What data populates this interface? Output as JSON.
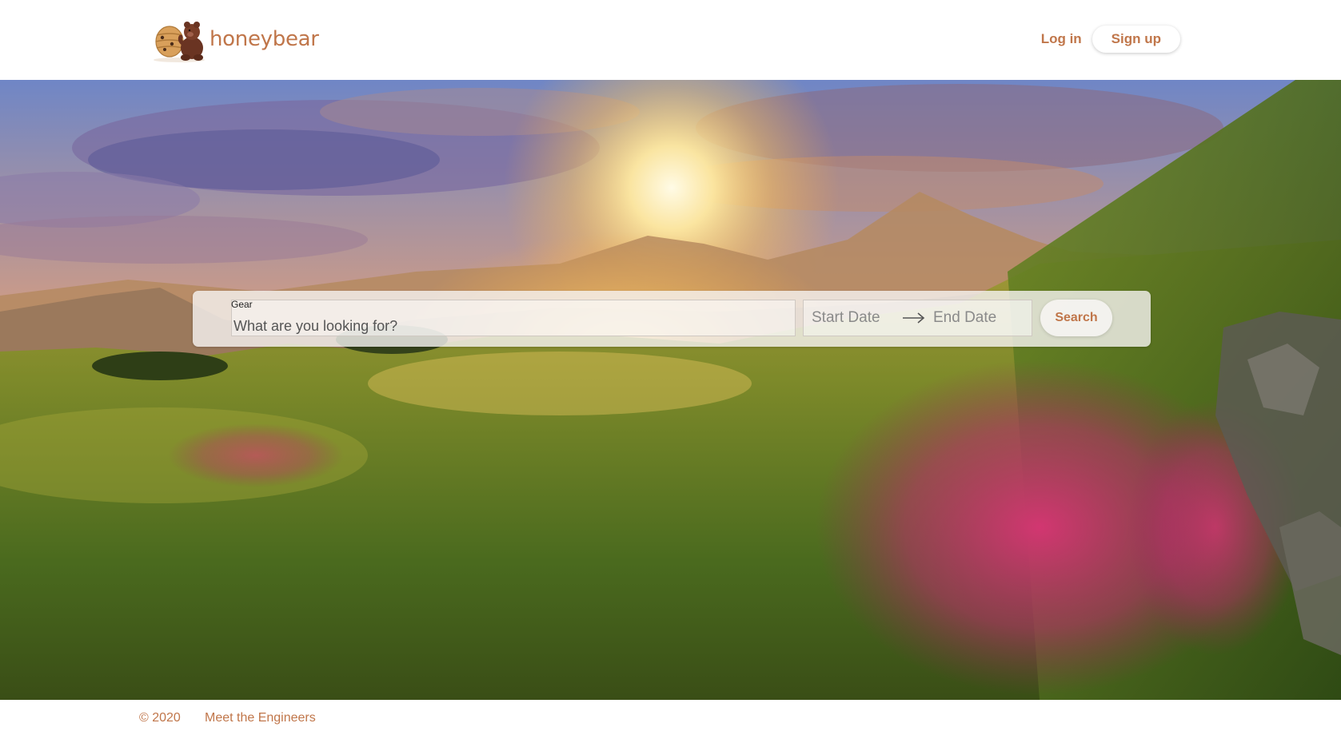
{
  "brand": {
    "name": "honeybear",
    "logo_icon": "honey-pot-bear-icon",
    "color": "#c0764a"
  },
  "header": {
    "login_label": "Log in",
    "signup_label": "Sign up"
  },
  "search": {
    "gear_label": "Gear",
    "gear_placeholder": "What are you looking for?",
    "start_date_placeholder": "Start Date",
    "end_date_placeholder": "End Date",
    "arrow_icon": "arrow-right-icon",
    "button_label": "Search"
  },
  "footer": {
    "copyright": "© 2020",
    "engineers_link": "Meet the Engineers"
  }
}
